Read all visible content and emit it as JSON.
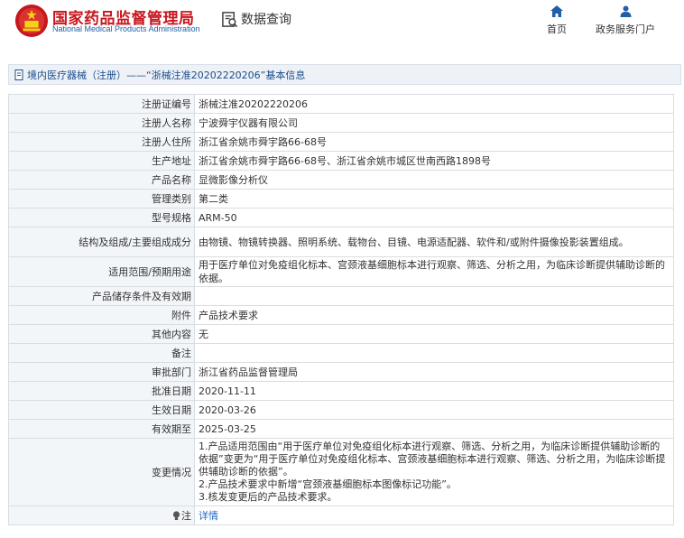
{
  "header": {
    "org_name_cn": "国家药品监督管理局",
    "org_name_en": "National Medical Products Administration",
    "search_query_label": "数据查询",
    "nav": [
      {
        "label": "首页",
        "icon": "home-icon"
      },
      {
        "label": "政务服务门户",
        "icon": "user-icon"
      }
    ]
  },
  "title": "境内医疗器械（注册）——“浙械注准20202220206”基本信息",
  "records": [
    {
      "key": "注册证编号",
      "value": "浙械注准20202220206"
    },
    {
      "key": "注册人名称",
      "value": "宁波舜宇仪器有限公司"
    },
    {
      "key": "注册人住所",
      "value": "浙江省余姚市舜宇路66-68号"
    },
    {
      "key": "生产地址",
      "value": "浙江省余姚市舜宇路66-68号、浙江省余姚市城区世南西路1898号"
    },
    {
      "key": "产品名称",
      "value": "显微影像分析仪"
    },
    {
      "key": "管理类别",
      "value": "第二类"
    },
    {
      "key": "型号规格",
      "value": "ARM-50"
    },
    {
      "key": "结构及组成/主要组成成分",
      "value": "由物镜、物镜转换器、照明系统、载物台、目镜、电源适配器、软件和/或附件摄像投影装置组成。"
    },
    {
      "key": "适用范围/预期用途",
      "value": "用于医疗单位对免疫组化标本、宫颈液基细胞标本进行观察、筛选、分析之用，为临床诊断提供辅助诊断的依据。"
    },
    {
      "key": "产品储存条件及有效期",
      "value": ""
    },
    {
      "key": "附件",
      "value": "产品技术要求"
    },
    {
      "key": "其他内容",
      "value": "无"
    },
    {
      "key": "备注",
      "value": ""
    },
    {
      "key": "审批部门",
      "value": "浙江省药品监督管理局"
    },
    {
      "key": "批准日期",
      "value": "2020-11-11"
    },
    {
      "key": "生效日期",
      "value": "2020-03-26"
    },
    {
      "key": "有效期至",
      "value": "2025-03-25"
    },
    {
      "key": "变更情况",
      "value": "1.产品适用范围由“用于医疗单位对免疫组化标本进行观察、筛选、分析之用，为临床诊断提供辅助诊断的依据”变更为“用于医疗单位对免疫组化标本、宫颈液基细胞标本进行观察、筛选、分析之用，为临床诊断提供辅助诊断的依据”。\n2.产品技术要求中新增“宫颈液基细胞标本图像标记功能”。\n3.核发变更后的产品技术要求。"
    },
    {
      "key": "注",
      "value": "详情"
    }
  ],
  "colors": {
    "brand_red": "#c8161d",
    "brand_blue": "#1f5fa8",
    "link_blue": "#1f68c7",
    "key_bg": "#f3f6f9"
  }
}
